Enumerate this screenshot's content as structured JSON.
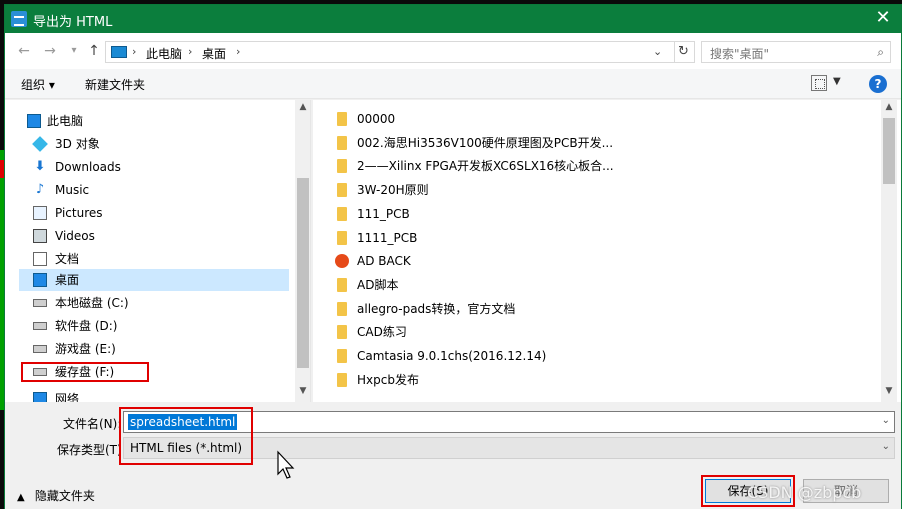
{
  "window": {
    "title": "导出为 HTML"
  },
  "nav": {
    "breadcrumb": [
      "此电脑",
      "桌面"
    ],
    "search_placeholder": "搜索\"桌面\""
  },
  "toolbar": {
    "organize": "组织 ▾",
    "new_folder": "新建文件夹",
    "help": "?"
  },
  "sidebar": {
    "root": "此电脑",
    "items": [
      {
        "label": "3D 对象",
        "icon": "cube-icon"
      },
      {
        "label": "Downloads",
        "icon": "download-arrow-icon"
      },
      {
        "label": "Music",
        "icon": "music-note-icon"
      },
      {
        "label": "Pictures",
        "icon": "picture-icon"
      },
      {
        "label": "Videos",
        "icon": "video-icon"
      },
      {
        "label": "文档",
        "icon": "document-icon"
      },
      {
        "label": "桌面",
        "icon": "desktop-icon",
        "selected": true
      },
      {
        "label": "本地磁盘 (C:)",
        "icon": "drive-icon"
      },
      {
        "label": "软件盘 (D:)",
        "icon": "drive-icon"
      },
      {
        "label": "游戏盘 (E:)",
        "icon": "drive-icon"
      },
      {
        "label": "缓存盘 (F:)",
        "icon": "drive-icon"
      },
      {
        "label": "网络",
        "icon": "network-icon"
      }
    ]
  },
  "files": [
    {
      "name": "00000",
      "type": "folder"
    },
    {
      "name": "002.海思Hi3536V100硬件原理图及PCB开发...",
      "type": "folder"
    },
    {
      "name": "2——Xilinx FPGA开发板XC6SLX16核心板合...",
      "type": "folder"
    },
    {
      "name": "3W-20H原则",
      "type": "folder"
    },
    {
      "name": "111_PCB",
      "type": "folder"
    },
    {
      "name": "1111_PCB",
      "type": "folder"
    },
    {
      "name": "AD BACK",
      "type": "app"
    },
    {
      "name": "AD脚本",
      "type": "folder"
    },
    {
      "name": "allegro-pads转换，官方文档",
      "type": "folder"
    },
    {
      "name": "CAD练习",
      "type": "folder"
    },
    {
      "name": "Camtasia 9.0.1chs(2016.12.14)",
      "type": "folder"
    },
    {
      "name": "Hxpcb发布",
      "type": "folder"
    }
  ],
  "form": {
    "filename_label": "文件名(N):",
    "filename_value": "spreadsheet.html",
    "filetype_label": "保存类型(T):",
    "filetype_value": "HTML files (*.html)"
  },
  "footer": {
    "hide_folders": "隐藏文件夹",
    "save": "保存(S)",
    "cancel": "取消",
    "watermark": "CSDN @zbpcb"
  }
}
